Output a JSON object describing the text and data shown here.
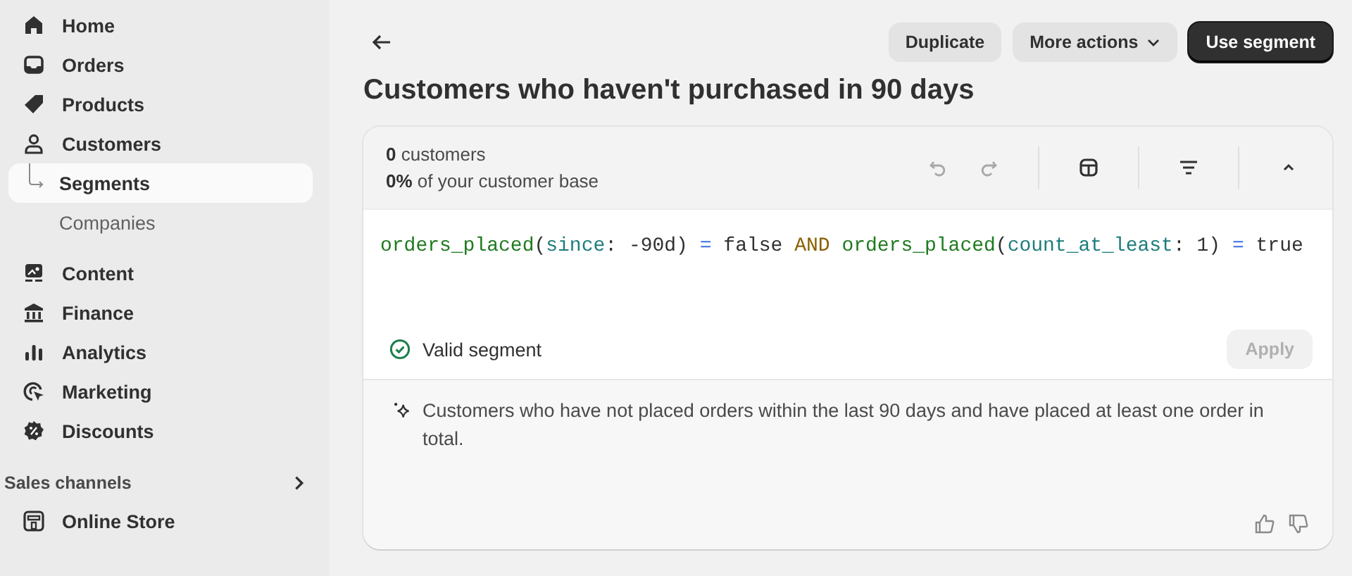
{
  "sidebar": {
    "items": [
      {
        "label": "Home",
        "selected": false
      },
      {
        "label": "Orders",
        "selected": false
      },
      {
        "label": "Products",
        "selected": false
      },
      {
        "label": "Customers",
        "selected": false,
        "children": [
          {
            "label": "Segments",
            "selected": true
          },
          {
            "label": "Companies",
            "selected": false
          }
        ]
      },
      {
        "label": "Content",
        "selected": false
      },
      {
        "label": "Finance",
        "selected": false
      },
      {
        "label": "Analytics",
        "selected": false
      },
      {
        "label": "Marketing",
        "selected": false
      },
      {
        "label": "Discounts",
        "selected": false
      }
    ],
    "sales_channels": {
      "heading": "Sales channels",
      "items": [
        {
          "label": "Online Store",
          "selected": false
        }
      ]
    }
  },
  "header": {
    "buttons": [
      {
        "label": "Duplicate",
        "kind": "secondary"
      },
      {
        "label": "More actions",
        "kind": "menu"
      },
      {
        "label": "Use segment",
        "kind": "primary"
      }
    ],
    "title": "Customers who haven't purchased in 90 days"
  },
  "card": {
    "count": "0",
    "count_label": "customers",
    "share": "0%",
    "share_label": "of your customer base",
    "toolbar": {
      "undo_disabled": true,
      "redo_disabled": true
    },
    "query": [
      {
        "text": "orders_placed",
        "kind": "func"
      },
      {
        "text": "(",
        "kind": "plain"
      },
      {
        "text": "since",
        "kind": "param"
      },
      {
        "text": ": -90d) ",
        "kind": "plain"
      },
      {
        "text": "=",
        "kind": "op"
      },
      {
        "text": " false ",
        "kind": "plain"
      },
      {
        "text": "AND ",
        "kind": "keyword"
      },
      {
        "text": "orders_placed",
        "kind": "func"
      },
      {
        "text": "(",
        "kind": "plain"
      },
      {
        "text": "count_at_least",
        "kind": "param"
      },
      {
        "text": ": 1) ",
        "kind": "plain"
      },
      {
        "text": "=",
        "kind": "op"
      },
      {
        "text": " true",
        "kind": "plain"
      }
    ],
    "status": "Valid segment",
    "apply": {
      "label": "Apply",
      "disabled": true
    },
    "summary": "Customers who have not placed orders within the last 90 days and have placed at least one order in total."
  }
}
